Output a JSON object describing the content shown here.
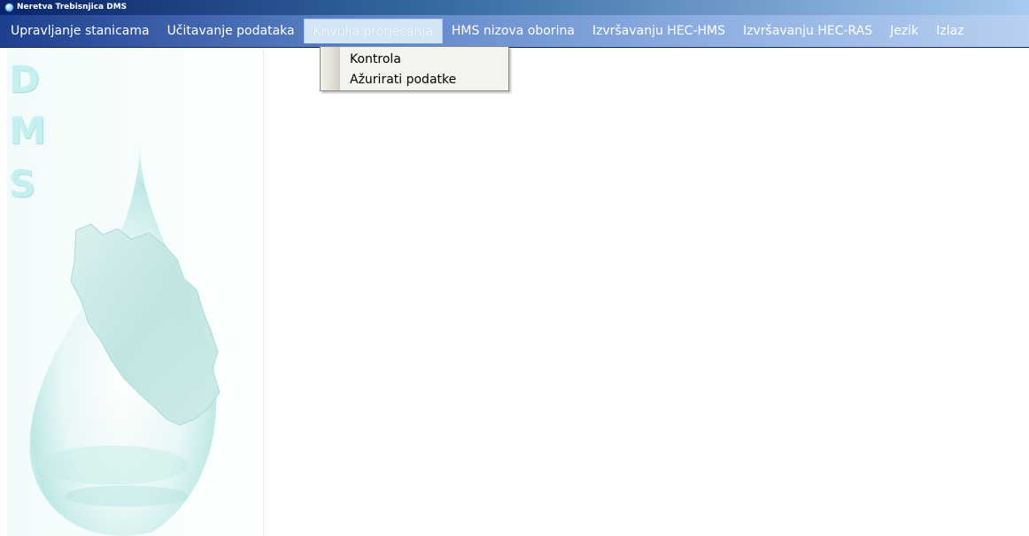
{
  "window": {
    "title": "Neretva Trebisnjica DMS"
  },
  "menubar": {
    "items": [
      {
        "label": "Upravljanje stanicama"
      },
      {
        "label": "Učitavanje podataka"
      },
      {
        "label": "Krivulja protjecanja",
        "active": true
      },
      {
        "label": "HMS nizova oborina"
      },
      {
        "label": "Izvršavanju HEC-HMS"
      },
      {
        "label": "Izvršavanju HEC-RAS"
      },
      {
        "label": "Jezik"
      },
      {
        "label": "Izlaz"
      }
    ]
  },
  "dropdown": {
    "items": [
      {
        "label": "Kontrola"
      },
      {
        "label": "Ažurirati podatke"
      }
    ]
  },
  "sidepanel": {
    "logo_letters": [
      "D",
      "M",
      "S"
    ]
  },
  "colors": {
    "menubar_start": "#1d3f8e",
    "menubar_end": "#b8d0f1",
    "logo_tint": "#c6f0f0"
  }
}
